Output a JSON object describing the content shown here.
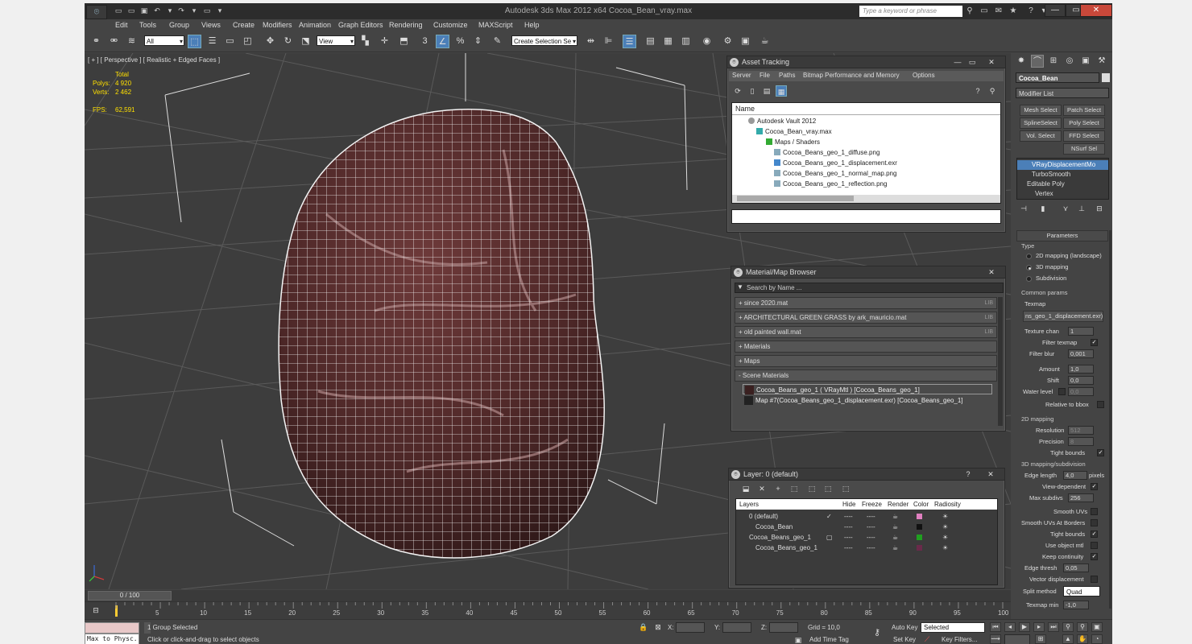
{
  "app": {
    "title": "Autodesk 3ds Max  2012 x64      Cocoa_Bean_vray.max",
    "logo": "3ds-max-logo",
    "search_placeholder": "Type a keyword or phrase"
  },
  "menus": [
    "Edit",
    "Tools",
    "Group",
    "Views",
    "Create",
    "Modifiers",
    "Animation",
    "Graph Editors",
    "Rendering",
    "Customize",
    "MAXScript",
    "Help"
  ],
  "toolbar": {
    "selection_filter": "All",
    "ref_coord": "View",
    "named_selection": "Create Selection Se",
    "snap_label": "3"
  },
  "viewport": {
    "label": "[ + ] [ Perspective ] [ Realistic + Edged Faces ]",
    "stats": {
      "total_label": "Total",
      "polys_label": "Polys:",
      "polys_value": "4 920",
      "verts_label": "Verts:",
      "verts_value": "2 462",
      "fps_label": "FPS:",
      "fps_value": "62,591"
    }
  },
  "asset_tracking": {
    "title": "Asset Tracking",
    "menu": [
      "Server",
      "File",
      "Paths",
      "Bitmap Performance and Memory",
      "Options"
    ],
    "column": "Name",
    "rows": [
      "Autodesk Vault 2012",
      "Cocoa_Bean_vray.max",
      "Maps / Shaders",
      "Cocoa_Beans_geo_1_diffuse.png",
      "Cocoa_Beans_geo_1_displacement.exr",
      "Cocoa_Beans_geo_1_normal_map.png",
      "Cocoa_Beans_geo_1_reflection.png"
    ]
  },
  "material_browser": {
    "title": "Material/Map Browser",
    "search_placeholder": "Search by Name ...",
    "rollouts": [
      {
        "label": "+ since 2020.mat",
        "lib": "LIB"
      },
      {
        "label": "+ ARCHITECTURAL GREEN GRASS by ark_mauricio.mat",
        "lib": "LIB"
      },
      {
        "label": "+ old painted wall.mat",
        "lib": "LIB"
      },
      {
        "label": "+ Materials",
        "lib": ""
      },
      {
        "label": "+ Maps",
        "lib": ""
      },
      {
        "label": "- Scene Materials",
        "lib": ""
      }
    ],
    "scene_items": [
      "Cocoa_Beans_geo_1  ( VRayMtl )  [Cocoa_Beans_geo_1]",
      "Map #7(Cocoa_Beans_geo_1_displacement.exr) [Cocoa_Beans_geo_1]"
    ]
  },
  "layer_manager": {
    "title": "Layer: 0 (default)",
    "columns": [
      "Layers",
      "Hide",
      "Freeze",
      "Render",
      "Color",
      "Radiosity"
    ],
    "rows": [
      {
        "name": "0 (default)",
        "indent": 0,
        "color": "#e080c0",
        "active": "✓"
      },
      {
        "name": "Cocoa_Bean",
        "indent": 1,
        "color": "#111111",
        "active": ""
      },
      {
        "name": "Cocoa_Beans_geo_1",
        "indent": 0,
        "color": "#20a020",
        "active": "▢"
      },
      {
        "name": "Cocoa_Beans_geo_1",
        "indent": 1,
        "color": "#6a2a4a",
        "active": ""
      }
    ],
    "cell_dots": "----"
  },
  "command_panel": {
    "object_name": "Cocoa_Bean",
    "modifier_list": "Modifier List",
    "buttons": [
      "Mesh Select",
      "Patch Select",
      "SplineSelect",
      "Poly Select",
      "Vol. Select",
      "FFD Select",
      "NSurf Sel"
    ],
    "stack": [
      "VRayDisplacementMo",
      "TurboSmooth",
      "Editable Poly",
      "Vertex"
    ],
    "params_title": "Parameters",
    "type_label": "Type",
    "type_options": [
      "2D mapping (landscape)",
      "3D mapping",
      "Subdivision"
    ],
    "common_params": "Common params",
    "texmap_label": "Texmap",
    "texmap_value": "ns_geo_1_displacement.exr)",
    "texture_chan_label": "Texture chan",
    "texture_chan_value": "1",
    "filter_texmap_label": "Filter texmap",
    "filter_blur_label": "Filter blur",
    "filter_blur_value": "0,001",
    "amount_label": "Amount",
    "amount_value": "1,0",
    "shift_label": "Shift",
    "shift_value": "0,0",
    "water_level_label": "Water level",
    "water_level_value": "0,0",
    "relative_label": "Relative to bbox",
    "mapping2d_label": "2D mapping",
    "resolution_label": "Resolution",
    "resolution_value": "512",
    "precision_label": "Precision",
    "precision_value": "8",
    "tight_bounds_label": "Tight bounds",
    "mapping3d_label": "3D mapping/subdivision",
    "edge_length_label": "Edge length",
    "edge_length_value": "4,0",
    "pixels_label": "pixels",
    "view_dependent_label": "View-dependent",
    "max_subdivs_label": "Max subdivs",
    "max_subdivs_value": "256",
    "smooth_uvs_label": "Smooth UVs",
    "smooth_uvs_borders_label": "Smooth UVs At Borders",
    "tight_bounds2_label": "Tight bounds",
    "use_object_mtl_label": "Use object mtl",
    "keep_continuity_label": "Keep continuity",
    "edge_thresh_label": "Edge thresh",
    "edge_thresh_value": "0,05",
    "vector_disp_label": "Vector displacement",
    "split_method_label": "Split method",
    "split_method_value": "Quad",
    "texmap_min_label": "Texmap min",
    "texmap_min_value": "-1,0"
  },
  "timeline": {
    "frame_label": "0 / 100",
    "ticks": [
      "0",
      "5",
      "10",
      "15",
      "20",
      "25",
      "30",
      "35",
      "40",
      "45",
      "50",
      "55",
      "60",
      "65",
      "70",
      "75",
      "80",
      "85",
      "90",
      "95",
      "100"
    ]
  },
  "status": {
    "maxscript_label": "Max to Physc.",
    "selection": "1 Group Selected",
    "prompt": "Click or click-and-drag to select objects",
    "x_label": "X:",
    "y_label": "Y:",
    "z_label": "Z:",
    "grid": "Grid = 10,0",
    "add_time_tag": "Add Time Tag",
    "auto_key": "Auto Key",
    "set_key": "Set Key",
    "selected": "Selected",
    "key_filters": "Key Filters..."
  },
  "colors": {
    "accent": "#4b7fb8",
    "mesh_wire": "#ffffff",
    "bean": "#5a2e2e",
    "stat_yellow": "#ffe000"
  }
}
